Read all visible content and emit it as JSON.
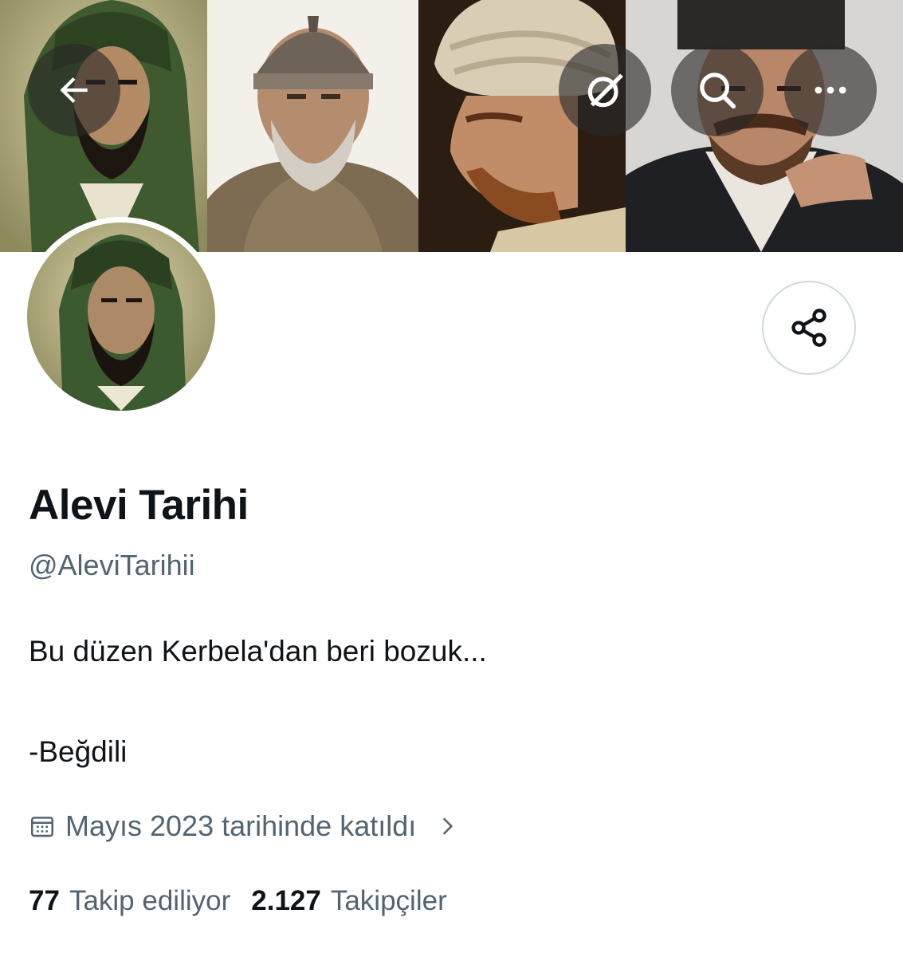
{
  "profile": {
    "name": "Alevi Tarihi",
    "handle": "@AleviTarihii",
    "bio_line1": "Bu düzen Kerbela'dan beri bozuk...",
    "bio_line2": "-Beğdili",
    "joined": "Mayıs 2023 tarihinde katıldı",
    "following_count": "77",
    "following_label": "Takip ediliyor",
    "followers_count": "2.127",
    "followers_label": "Takipçiler"
  },
  "icons": {
    "back": "arrow-left-icon",
    "grok": "grok-icon",
    "search": "search-icon",
    "more": "more-icon",
    "share": "share-icon",
    "calendar": "calendar-icon",
    "chevron": "chevron-right-icon"
  },
  "colors": {
    "primary_text": "#0f1419",
    "secondary_text": "#536471",
    "border": "#cfd9de"
  }
}
